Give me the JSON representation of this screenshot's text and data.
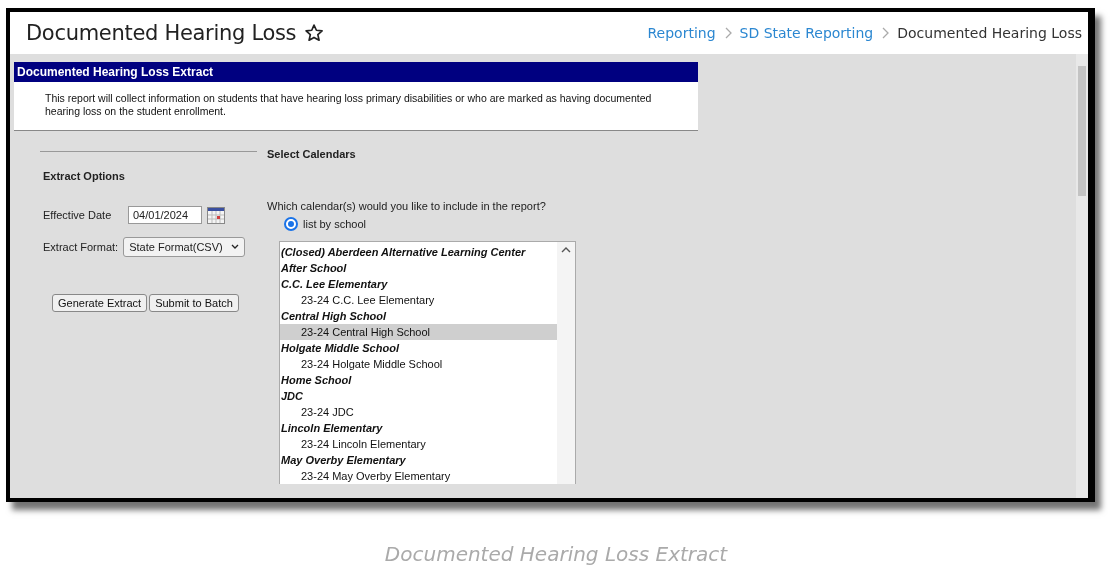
{
  "header": {
    "title": "Documented Hearing Loss",
    "favorite": false,
    "breadcrumbs": [
      {
        "label": "Reporting",
        "kind": "link"
      },
      {
        "label": "SD State Reporting",
        "kind": "link"
      },
      {
        "label": "Documented Hearing Loss",
        "kind": "current"
      }
    ]
  },
  "panel": {
    "title": "Documented Hearing Loss Extract",
    "description": "This report will collect information on students that have hearing loss primary disabilities or who are marked as having documented hearing loss on the student enrollment."
  },
  "extract_options": {
    "heading": "Extract Options",
    "effective_date": {
      "label": "Effective Date",
      "value": "04/01/2024"
    },
    "extract_format": {
      "label": "Extract Format:",
      "value": "State Format(CSV)"
    },
    "buttons": [
      "Generate Extract",
      "Submit to Batch"
    ]
  },
  "calendars": {
    "heading": "Select Calendars",
    "question": "Which calendar(s) would you like to include in the report?",
    "radio": {
      "label": "list by school",
      "selected": true
    },
    "items": [
      {
        "kind": "school",
        "label": "(Closed) Aberdeen Alternative Learning Center"
      },
      {
        "kind": "school",
        "label": "After School"
      },
      {
        "kind": "school",
        "label": "C.C. Lee Elementary"
      },
      {
        "kind": "calendar",
        "label": "23-24 C.C. Lee Elementary",
        "selected": false
      },
      {
        "kind": "school",
        "label": "Central High School"
      },
      {
        "kind": "calendar",
        "label": "23-24 Central High School",
        "selected": true
      },
      {
        "kind": "school",
        "label": "Holgate Middle School"
      },
      {
        "kind": "calendar",
        "label": "23-24 Holgate Middle School",
        "selected": false
      },
      {
        "kind": "school",
        "label": "Home School"
      },
      {
        "kind": "school",
        "label": "JDC"
      },
      {
        "kind": "calendar",
        "label": "23-24 JDC",
        "selected": false
      },
      {
        "kind": "school",
        "label": "Lincoln Elementary"
      },
      {
        "kind": "calendar",
        "label": "23-24 Lincoln Elementary",
        "selected": false
      },
      {
        "kind": "school",
        "label": "May Overby Elementary"
      },
      {
        "kind": "calendar",
        "label": "23-24 May Overby Elementary",
        "selected": false
      }
    ]
  },
  "caption": "Documented Hearing Loss Extract"
}
